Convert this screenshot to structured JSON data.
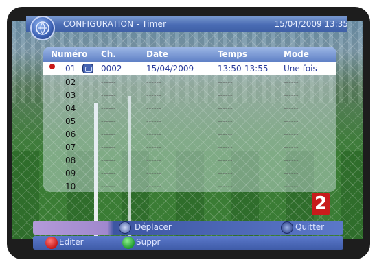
{
  "title": {
    "label": "CONFIGURATION - Timer",
    "datetime": "15/04/2009 13:35",
    "icon": "settings-globe-icon"
  },
  "table": {
    "columns": [
      "Numéro",
      "Ch.",
      "Date",
      "Temps",
      "Mode"
    ],
    "rows": [
      {
        "num": "01",
        "ch": "0002",
        "date": "15/04/2009",
        "time": "13:50-13:55",
        "mode": "Une fois"
      },
      {
        "num": "02",
        "ch": "------",
        "date": "------",
        "time": "------",
        "mode": "------"
      },
      {
        "num": "03",
        "ch": "------",
        "date": "------",
        "time": "------",
        "mode": "------"
      },
      {
        "num": "04",
        "ch": "------",
        "date": "------",
        "time": "------",
        "mode": "------"
      },
      {
        "num": "05",
        "ch": "------",
        "date": "------",
        "time": "------",
        "mode": "------"
      },
      {
        "num": "06",
        "ch": "------",
        "date": "------",
        "time": "------",
        "mode": "------"
      },
      {
        "num": "07",
        "ch": "------",
        "date": "------",
        "time": "------",
        "mode": "------"
      },
      {
        "num": "08",
        "ch": "------",
        "date": "------",
        "time": "------",
        "mode": "------"
      },
      {
        "num": "09",
        "ch": "------",
        "date": "------",
        "time": "------",
        "mode": "------"
      },
      {
        "num": "10",
        "ch": "------",
        "date": "------",
        "time": "------",
        "mode": "------"
      }
    ]
  },
  "channel_logo": "2",
  "footer": {
    "move_label": "Déplacer",
    "quit_label": "Quitter",
    "edit_label": "Editer",
    "delete_label": "Suppr"
  },
  "colors": {
    "accent": "#4a6cb4",
    "selected_text": "#2a3c9a",
    "record_dot": "#c81818",
    "red_button": "#d02a2a",
    "green_button": "#2aa83a"
  }
}
